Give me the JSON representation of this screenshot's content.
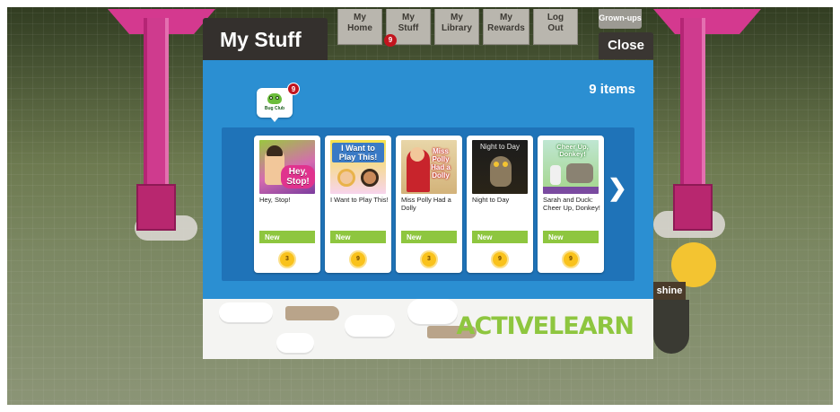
{
  "nav": {
    "tabs": [
      {
        "label": "My\nHome"
      },
      {
        "label": "My\nStuff"
      },
      {
        "label": "My\nLibrary"
      },
      {
        "label": "My\nRewards"
      },
      {
        "label": "Log\nOut"
      }
    ],
    "stuff_badge": "9",
    "grownups_label": "Grown-ups"
  },
  "dialog": {
    "title": "My Stuff",
    "close_label": "Close",
    "item_count": "9 items",
    "bugclub_label": "Bug Club",
    "bugclub_badge": "9",
    "books": [
      {
        "title": "Hey, Stop!",
        "cover_text": "Hey, Stop!",
        "badge": "New",
        "level": "3"
      },
      {
        "title": "I Want to Play This!",
        "cover_text": "I Want to Play This!",
        "badge": "New",
        "level": "9"
      },
      {
        "title": "Miss Polly Had a Dolly",
        "cover_text": "Miss Polly Had a Dolly",
        "badge": "New",
        "level": "3"
      },
      {
        "title": "Night to Day",
        "cover_text": "Night to Day",
        "badge": "New",
        "level": "9"
      },
      {
        "title": "Sarah and Duck: Cheer Up, Donkey!",
        "cover_text": "Cheer Up, Donkey!",
        "badge": "New",
        "level": "9"
      }
    ],
    "footer_logo": "ACTIVELEARN"
  },
  "background": {
    "shine_text": "shine"
  },
  "colors": {
    "panel_blue": "#2b8fd2",
    "shelf_blue": "#1f73b8",
    "new_green": "#8ec63f",
    "level_gold": "#f9c21c",
    "badge_red": "#c2141e",
    "pylon_pink": "#cf3b8e"
  }
}
